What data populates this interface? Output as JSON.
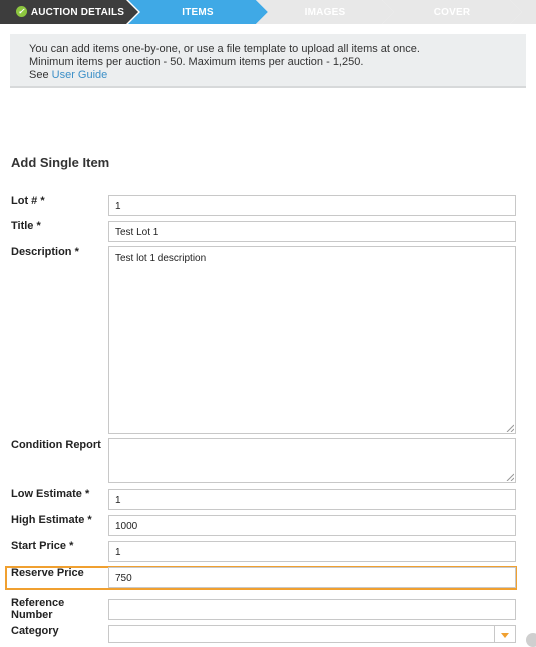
{
  "steps": [
    {
      "label": "AUCTION DETAILS",
      "state": "done"
    },
    {
      "label": "ITEMS",
      "state": "active"
    },
    {
      "label": "IMAGES",
      "state": "off"
    },
    {
      "label": "COVER",
      "state": "off"
    }
  ],
  "colors": {
    "done": "#3d3d3d",
    "active": "#3fa9e6",
    "off": "#e8e8e8",
    "highlight": "#f0a030"
  },
  "info": {
    "line1": "You can add items one-by-one, or use a file template to upload all items at once.",
    "line2": "Minimum items per auction - 50. Maximum items per auction - 1,250.",
    "see": "See",
    "guide_link": "User Guide"
  },
  "form": {
    "title": "Add Single Item",
    "lot_label": "Lot # *",
    "lot_value": "1",
    "title_label": "Title *",
    "title_value": "Test Lot 1",
    "description_label": "Description *",
    "description_value": "Test lot 1 description",
    "condition_label": "Condition Report",
    "condition_value": "",
    "low_label": "Low Estimate *",
    "low_value": "1",
    "high_label": "High Estimate *",
    "high_value": "1000",
    "start_label": "Start Price *",
    "start_value": "1",
    "reserve_label": "Reserve Price",
    "reserve_value": "750",
    "reference_label": "Reference Number",
    "reference_value": "",
    "category_label": "Category",
    "category_value": ""
  }
}
